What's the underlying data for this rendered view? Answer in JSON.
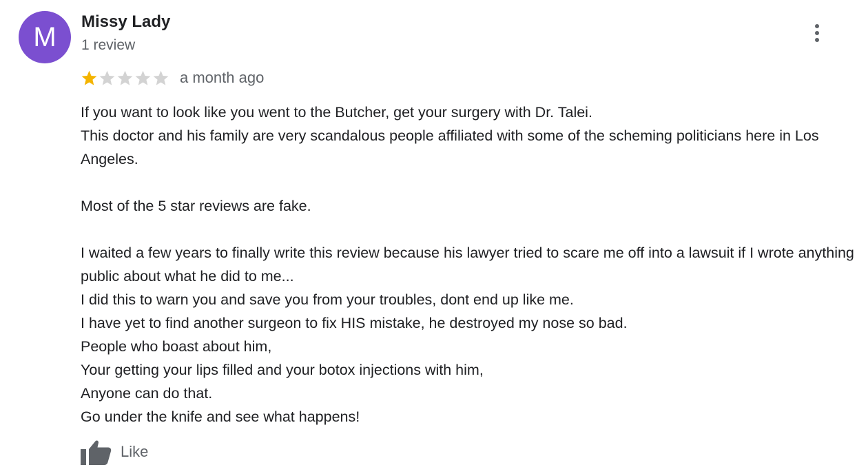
{
  "review": {
    "avatar_letter": "M",
    "avatar_color": "#7b4fd0",
    "author_name": "Missy Lady",
    "review_count": "1 review",
    "rating": 1,
    "rating_max": 5,
    "star_filled_color": "#f4b400",
    "star_empty_color": "#d3d3d3",
    "time_ago": "a month ago",
    "text": "If you want to look like you went to the Butcher, get your surgery with Dr. Talei.\nThis doctor and his family are very scandalous people affiliated with some of the scheming politicians here in Los Angeles.\n\nMost of the 5 star reviews are fake.\n\nI waited a few years to finally write this review because his lawyer tried to scare me off into a lawsuit if I wrote anything public about what he did to me...\nI did this to warn you and save you from your troubles, dont end up like me.\nI have yet to find another surgeon to fix HIS mistake, he destroyed my nose so bad.\nPeople who boast about him,\nYour getting your lips filled and your botox injections with him,\nAnyone can do that.\nGo under the knife and see what happens!"
  },
  "actions": {
    "more_icon": "more-vert-icon",
    "like_icon": "thumb-up-icon",
    "like_label": "Like"
  }
}
